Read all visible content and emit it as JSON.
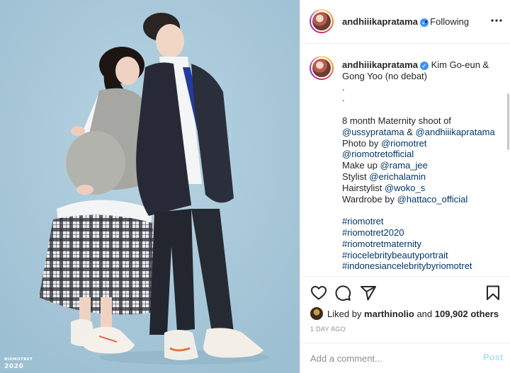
{
  "post": {
    "username": "andhiiikapratama",
    "verified": true,
    "follow_status": "• Following",
    "more_icon": "more-horizontal-icon"
  },
  "photo": {
    "watermark_brand": "RIOMOTRET",
    "watermark_year": "2020"
  },
  "caption": {
    "username": "andhiiikapratama",
    "lines": [
      "Kim Go-eun &",
      "Gong Yoo (no debat)",
      ".",
      ".",
      "",
      "8 month Maternity shoot of",
      "",
      "Photo by ",
      "",
      "Make up ",
      "Stylist ",
      "Hairstylist ",
      "Wardrobe by ",
      ""
    ],
    "mentions": {
      "ussy": "@ussypratama",
      "amp": " & ",
      "andhi": "@andhiiikapratama",
      "riomotret": "@riomotret",
      "riomotretofficial": "@riomotretofficial",
      "rama": "@rama_jee",
      "erich": "@erichalamin",
      "woko": "@woko_s",
      "hattaco": "@hattaco_official"
    },
    "hashtags": [
      "#riomotret",
      "#riomotret2020",
      "#riomotretmaternity",
      "#riocelebritybeautyportrait",
      "#indonesiancelebritybyriomotret"
    ]
  },
  "actions": {
    "like_icon": "heart-icon",
    "comment_icon": "comment-icon",
    "share_icon": "send-icon",
    "save_icon": "bookmark-icon"
  },
  "likes": {
    "prefix": "Liked by ",
    "user": "marthinolio",
    "middle": " and ",
    "count": "109,902 others"
  },
  "timestamp": "1 DAY AGO",
  "comment": {
    "placeholder": "Add a comment...",
    "post_label": "Post"
  },
  "colors": {
    "link": "#00376b",
    "verified": "#3897f0",
    "post_button": "#b2dffc",
    "photo_background": "#a9c9da"
  }
}
